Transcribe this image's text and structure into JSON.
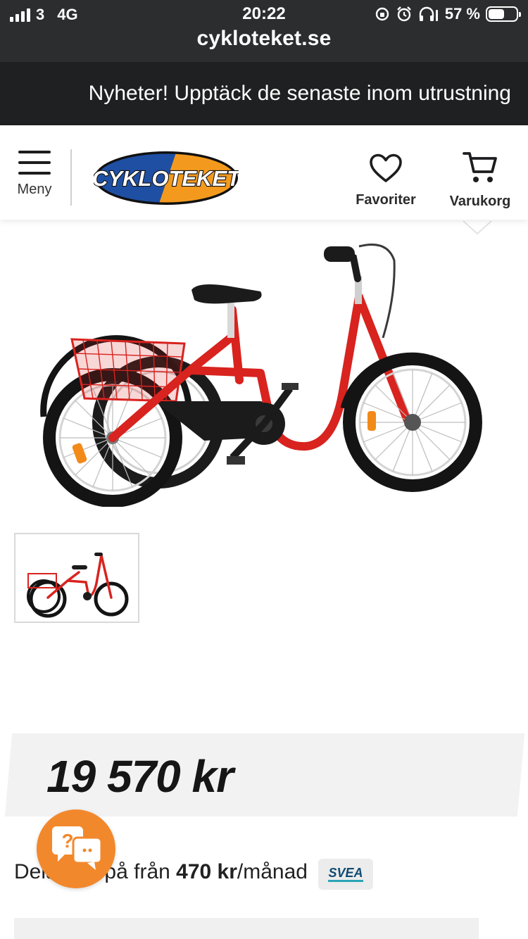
{
  "status_bar": {
    "carrier": "3",
    "network": "4G",
    "time": "20:22",
    "battery_percent_label": "57 %",
    "battery_level": 0.57
  },
  "browser": {
    "url": "cykloteket.se"
  },
  "promo": {
    "text": "Nyheter! Upptäck de senaste inom utrustning"
  },
  "header": {
    "menu_label": "Meny",
    "logo_text": "CYKLOTEKET",
    "favorites_label": "Favoriter",
    "cart_label": "Varukorg"
  },
  "product": {
    "price": "19 570 kr",
    "installment_prefix": "Dela upp på från",
    "installment_amount": "470 kr",
    "installment_suffix": "/månad",
    "payment_provider": "SVEA"
  },
  "colors": {
    "chrome_dark": "#2b2d2e",
    "logo_blue": "#1e4fa3",
    "logo_orange": "#f39a1e",
    "bike_red": "#d8231f",
    "chat_orange": "#f2882c",
    "price_bg": "#f2f2f2"
  },
  "icons": {
    "menu": "hamburger-icon",
    "favorites": "heart-icon",
    "cart": "cart-icon",
    "chat": "chat-help-icon"
  }
}
